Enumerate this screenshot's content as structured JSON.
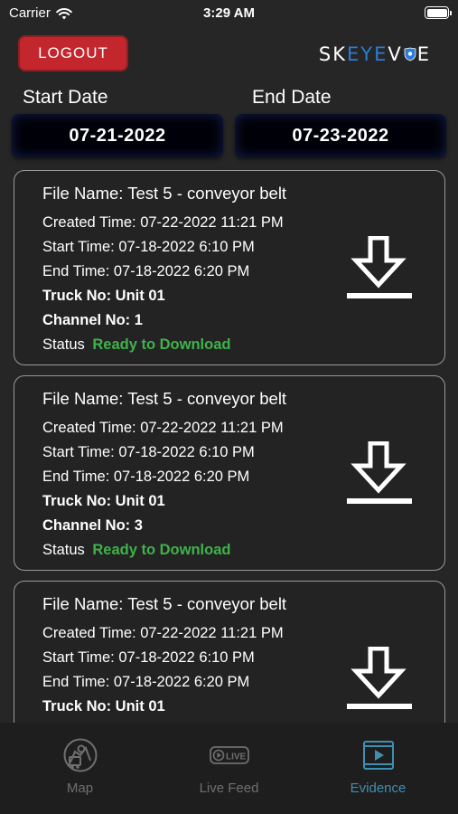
{
  "status_bar": {
    "carrier": "Carrier",
    "time": "3:29 AM"
  },
  "header": {
    "logout_label": "LOGOUT",
    "brand": {
      "part1": "SK",
      "part2": "EYE",
      "part3": "V",
      "part4": "E"
    }
  },
  "filters": {
    "start_label": "Start Date",
    "end_label": "End Date",
    "start_value": "07-21-2022",
    "end_value": "07-23-2022"
  },
  "evidence": {
    "items": [
      {
        "file_name": "File Name: Test 5 - conveyor belt",
        "created": "Created Time: 07-22-2022 11:21 PM",
        "start": "Start Time: 07-18-2022 6:10 PM",
        "end": "End Time: 07-18-2022 6:20 PM",
        "truck": "Truck No: Unit 01",
        "channel": "Channel No: 1",
        "status_label": "Status",
        "status_value": "Ready to Download"
      },
      {
        "file_name": "File Name: Test 5 - conveyor belt",
        "created": "Created Time: 07-22-2022 11:21 PM",
        "start": "Start Time: 07-18-2022 6:10 PM",
        "end": "End Time: 07-18-2022 6:20 PM",
        "truck": "Truck No: Unit 01",
        "channel": "Channel No: 3",
        "status_label": "Status",
        "status_value": "Ready to Download"
      },
      {
        "file_name": "File Name: Test 5 - conveyor belt",
        "created": "Created Time: 07-22-2022 11:21 PM",
        "start": "Start Time: 07-18-2022 6:10 PM",
        "end": "End Time: 07-18-2022 6:20 PM",
        "truck": "Truck No: Unit 01"
      }
    ]
  },
  "tabs": {
    "map": "Map",
    "live": "Live Feed",
    "live_badge": "LIVE",
    "evidence": "Evidence"
  },
  "colors": {
    "logout_bg": "#c4262e",
    "brand_accent": "#2d7bd6",
    "status_ready": "#3fb24a",
    "tab_active": "#3f8fb0"
  },
  "icons": {
    "wifi": "wifi-icon",
    "battery": "battery-icon",
    "download": "download-icon",
    "map": "map-icon",
    "live": "live-feed-icon",
    "evidence": "evidence-video-icon"
  }
}
